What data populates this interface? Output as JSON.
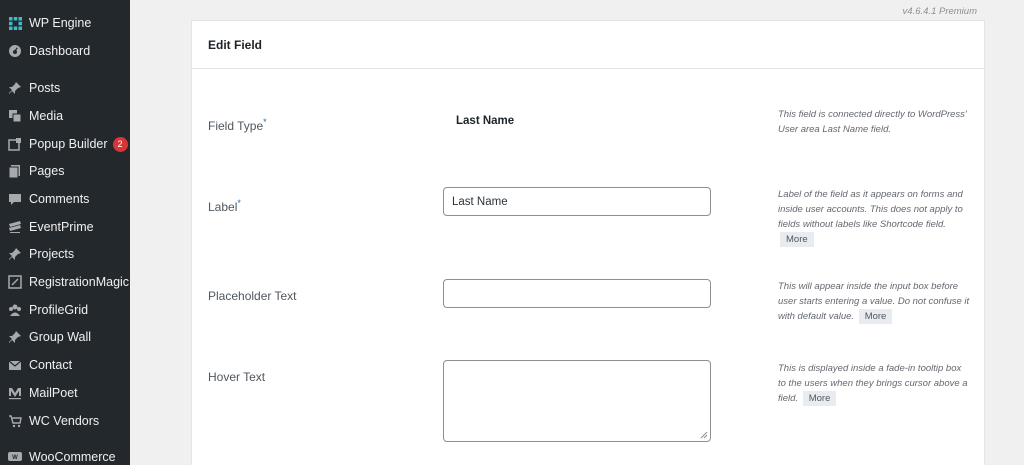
{
  "sidebar": {
    "items": [
      {
        "label": "WP Engine",
        "icon": "wp-engine-icon"
      },
      {
        "label": "Dashboard",
        "icon": "dashboard-icon"
      },
      {
        "label": "Posts",
        "icon": "pin-icon"
      },
      {
        "label": "Media",
        "icon": "media-icon"
      },
      {
        "label": "Popup Builder",
        "icon": "popup-icon",
        "badge": "2"
      },
      {
        "label": "Pages",
        "icon": "pages-icon"
      },
      {
        "label": "Comments",
        "icon": "comment-icon"
      },
      {
        "label": "EventPrime",
        "icon": "eventprime-icon"
      },
      {
        "label": "Projects",
        "icon": "pin-icon"
      },
      {
        "label": "RegistrationMagic",
        "icon": "registrationmagic-icon"
      },
      {
        "label": "ProfileGrid",
        "icon": "profilegrid-icon"
      },
      {
        "label": "Group Wall",
        "icon": "pin-icon"
      },
      {
        "label": "Contact",
        "icon": "mail-icon"
      },
      {
        "label": "MailPoet",
        "icon": "mailpoet-icon"
      },
      {
        "label": "WC Vendors",
        "icon": "cart-icon"
      },
      {
        "label": "WooCommerce",
        "icon": "woocommerce-icon"
      }
    ]
  },
  "version": "v4.6.4.1 Premium",
  "card": {
    "title": "Edit Field",
    "rows": {
      "field_type": {
        "label": "Field Type",
        "required_mark": "*",
        "value": "Last Name",
        "help": "This field is connected directly to WordPress' User area Last Name field."
      },
      "label": {
        "label": "Label",
        "required_mark": "*",
        "value": "Last Name",
        "help": "Label of the field as it appears on forms and inside user accounts. This does not apply to fields without labels like Shortcode field.",
        "more": "More"
      },
      "placeholder": {
        "label": "Placeholder Text",
        "value": "",
        "help": "This will appear inside the input box before user starts entering a value. Do not confuse it with default value.",
        "more": "More"
      },
      "hover": {
        "label": "Hover Text",
        "value": "",
        "help": "This is displayed inside a fade-in tooltip box to the users when they brings cursor above a field.",
        "more": "More"
      }
    }
  },
  "colors": {
    "sidebar_bg": "#23282d",
    "page_bg": "#f0f0f1",
    "badge_bg": "#d63638",
    "required_mark": "#2271b1"
  }
}
